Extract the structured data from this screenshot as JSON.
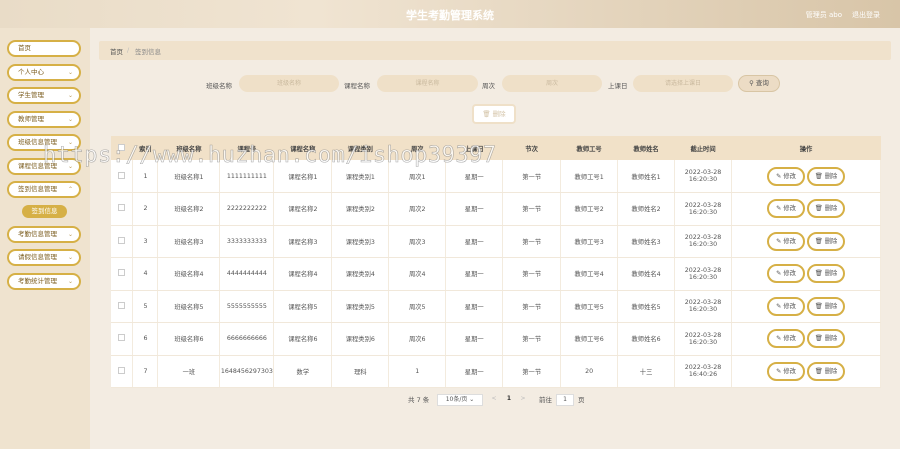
{
  "header": {
    "title": "学生考勤管理系统",
    "user": "管理员 abo",
    "logout": "退出登录"
  },
  "sidebar": {
    "items": [
      {
        "label": "首页",
        "chevron": false
      },
      {
        "label": "个人中心",
        "chevron": true
      },
      {
        "label": "学生管理",
        "chevron": true
      },
      {
        "label": "教师管理",
        "chevron": true
      },
      {
        "label": "班级信息管理",
        "chevron": true
      },
      {
        "label": "课程信息管理",
        "chevron": true
      },
      {
        "label": "签到信息管理",
        "chevron": true
      }
    ],
    "sub_item": "签到信息",
    "items2": [
      {
        "label": "考勤信息管理"
      },
      {
        "label": "请假信息管理"
      },
      {
        "label": "考勤统计管理"
      }
    ]
  },
  "breadcrumb": {
    "home": "首页",
    "sep": "/",
    "current": "签到信息"
  },
  "search": {
    "class_label": "班级名称",
    "class_placeholder": "班级名称",
    "course_label": "课程名称",
    "course_placeholder": "课程名称",
    "week_label": "周次",
    "week_placeholder": "周次",
    "day_label": "上课日",
    "day_placeholder": "请选择上课日",
    "search_button": "查询"
  },
  "delete_button": "删除",
  "table": {
    "headers": [
      "",
      "索引",
      "班级名称",
      "课程号",
      "课程名称",
      "课程类别",
      "周次",
      "上课日",
      "节次",
      "教师工号",
      "教师姓名",
      "截止时间",
      "操作"
    ],
    "rows": [
      [
        "1",
        "班级名称1",
        "1111111111",
        "课程名称1",
        "课程类别1",
        "周次1",
        "星期一",
        "第一节",
        "教师工号1",
        "教师姓名1",
        "2022-03-28 16:20:30"
      ],
      [
        "2",
        "班级名称2",
        "2222222222",
        "课程名称2",
        "课程类别2",
        "周次2",
        "星期一",
        "第一节",
        "教师工号2",
        "教师姓名2",
        "2022-03-28 16:20:30"
      ],
      [
        "3",
        "班级名称3",
        "3333333333",
        "课程名称3",
        "课程类别3",
        "周次3",
        "星期一",
        "第一节",
        "教师工号3",
        "教师姓名3",
        "2022-03-28 16:20:30"
      ],
      [
        "4",
        "班级名称4",
        "4444444444",
        "课程名称4",
        "课程类别4",
        "周次4",
        "星期一",
        "第一节",
        "教师工号4",
        "教师姓名4",
        "2022-03-28 16:20:30"
      ],
      [
        "5",
        "班级名称5",
        "5555555555",
        "课程名称5",
        "课程类别5",
        "周次5",
        "星期一",
        "第一节",
        "教师工号5",
        "教师姓名5",
        "2022-03-28 16:20:30"
      ],
      [
        "6",
        "班级名称6",
        "6666666666",
        "课程名称6",
        "课程类别6",
        "周次6",
        "星期一",
        "第一节",
        "教师工号6",
        "教师姓名6",
        "2022-03-28 16:20:30"
      ],
      [
        "7",
        "一班",
        "1648456297303",
        "数学",
        "理科",
        "1",
        "星期一",
        "第一节",
        "20",
        "十三",
        "2022-03-28 16:40:26"
      ]
    ],
    "edit_label": "修改",
    "delete_label": "删除"
  },
  "pagination": {
    "total": "共 7 条",
    "page_size": "10条/页",
    "prev": "<",
    "page": "1",
    "next": ">",
    "goto_label": "前往",
    "goto_value": "1",
    "goto_suffix": "页"
  },
  "watermark": "https://www.huzhan.com/ishop39397"
}
